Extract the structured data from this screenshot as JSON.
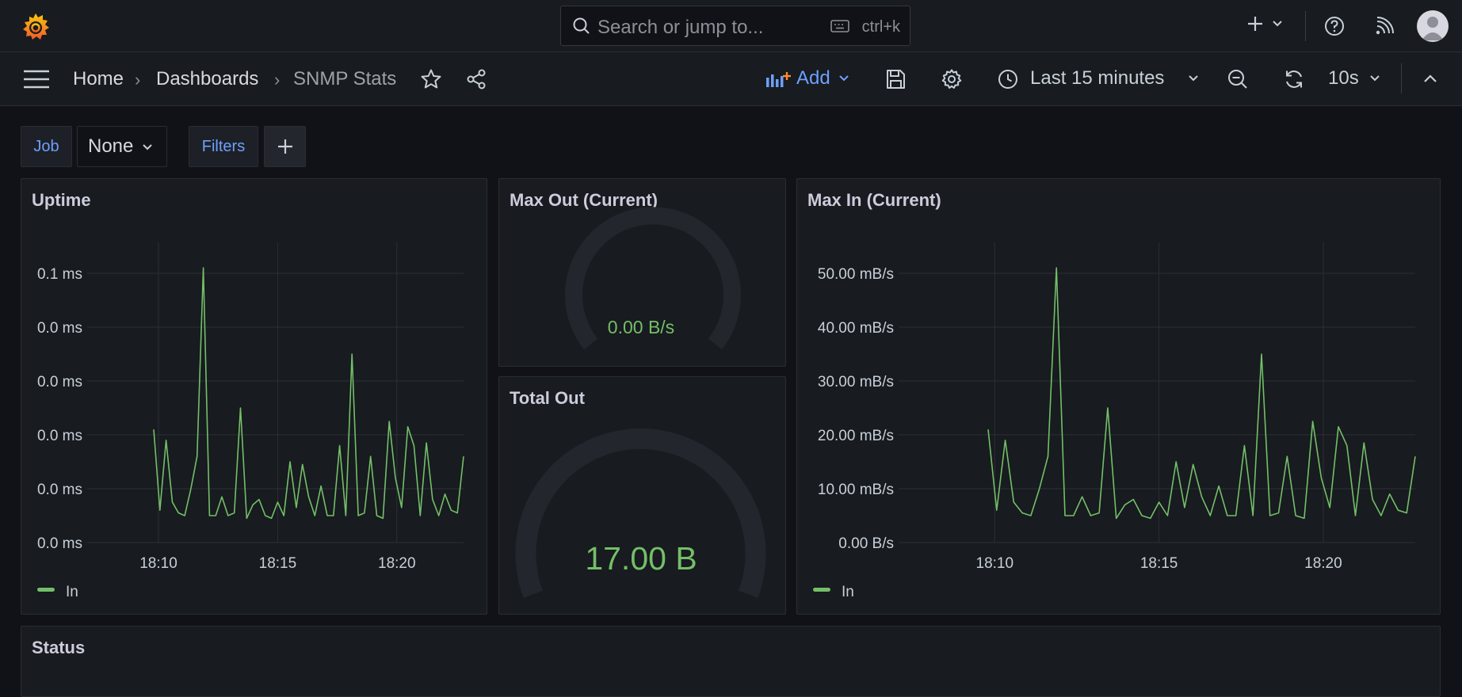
{
  "topbar": {
    "search_placeholder": "Search or jump to...",
    "search_shortcut": "ctrl+k",
    "icons": [
      "grafana-logo",
      "search-icon",
      "keyboard-icon",
      "plus-icon",
      "chevron-down-icon",
      "help-icon",
      "rss-icon",
      "avatar"
    ]
  },
  "navbar": {
    "breadcrumbs": [
      "Home",
      "Dashboards",
      "SNMP Stats"
    ],
    "add_label": "Add",
    "time_range": "Last 15 minutes",
    "refresh_interval": "10s"
  },
  "variables": {
    "job_label": "Job",
    "job_value": "None",
    "filters_label": "Filters"
  },
  "colors": {
    "series_green": "#73bf69",
    "accent_blue": "#6e9fff",
    "background": "#111217",
    "panel": "#181b1f"
  },
  "panels": {
    "uptime": {
      "title": "Uptime"
    },
    "max_out": {
      "title": "Max Out (Current)",
      "value": "0.00 B/s",
      "gauge_fraction": 0
    },
    "total_out": {
      "title": "Total Out",
      "value": "17.00 B",
      "gauge_fraction": 0
    },
    "max_in": {
      "title": "Max In (Current)"
    },
    "status": {
      "title": "Status"
    }
  },
  "chart_data": [
    {
      "type": "line",
      "panel": "uptime",
      "x": [
        "18:09.8",
        "18:10.1",
        "18:10.3",
        "18:10.6",
        "18:11.0",
        "18:11.3",
        "18:11.8",
        "18:12.0",
        "18:12.3",
        "18:12.5",
        "18:12.8",
        "18:13.1",
        "18:13.4",
        "18:13.7",
        "18:14.0",
        "18:14.3",
        "18:14.6",
        "18:14.8",
        "18:15.1",
        "18:15.4",
        "18:15.7",
        "18:15.9",
        "18:16.2",
        "18:16.5",
        "18:16.7",
        "18:17.0",
        "18:17.3",
        "18:17.6",
        "18:17.8",
        "18:18.1",
        "18:18.3",
        "18:18.6",
        "18:18.9",
        "18:19.2",
        "18:19.4",
        "18:19.7",
        "18:20.0",
        "18:20.2",
        "18:20.5",
        "18:20.8",
        "18:21.1",
        "18:21.4",
        "18:21.6",
        "18:21.9",
        "18:22.2",
        "18:22.5",
        "18:22.8"
      ],
      "values": [
        21,
        6,
        19,
        7.5,
        5.5,
        5,
        10,
        16,
        51,
        5,
        5,
        8.5,
        5,
        5.5,
        25,
        4.5,
        7,
        8,
        5,
        4.5,
        7.5,
        5,
        15,
        6.5,
        14.5,
        8.5,
        5,
        10.5,
        5,
        5,
        18,
        5,
        35,
        5,
        5.5,
        16,
        5,
        4.5,
        22.5,
        12,
        6.5,
        21.5,
        18,
        5,
        18.5,
        8,
        5,
        9,
        6,
        5.5,
        16
      ],
      "series": [
        {
          "name": "In"
        }
      ],
      "yticks": [
        "0.0 ms",
        "0.0 ms",
        "0.0 ms",
        "0.0 ms",
        "0.0 ms",
        "0.1 ms"
      ],
      "xticks": [
        "18:10",
        "18:15",
        "18:20"
      ],
      "ylim": [
        0,
        50
      ],
      "legend": "bottom-left",
      "grid": true
    },
    {
      "type": "line",
      "panel": "max_in",
      "values": [
        21,
        6,
        19,
        7.5,
        5.5,
        5,
        10,
        16,
        51,
        5,
        5,
        8.5,
        5,
        5.5,
        25,
        4.5,
        7,
        8,
        5,
        4.5,
        7.5,
        5,
        15,
        6.5,
        14.5,
        8.5,
        5,
        10.5,
        5,
        5,
        18,
        5,
        35,
        5,
        5.5,
        16,
        5,
        4.5,
        22.5,
        12,
        6.5,
        21.5,
        18,
        5,
        18.5,
        8,
        5,
        9,
        6,
        5.5,
        16
      ],
      "series": [
        {
          "name": "In"
        }
      ],
      "yticks": [
        "0.00 B/s",
        "10.00 mB/s",
        "20.00 mB/s",
        "30.00 mB/s",
        "40.00 mB/s",
        "50.00 mB/s"
      ],
      "xticks": [
        "18:10",
        "18:15",
        "18:20"
      ],
      "ylim": [
        0,
        50
      ],
      "legend": "bottom-left",
      "grid": true
    }
  ]
}
